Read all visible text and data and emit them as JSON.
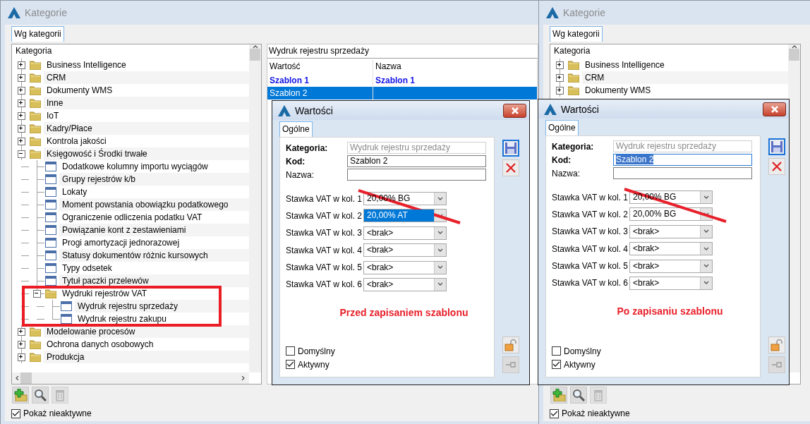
{
  "windows": [
    {
      "title": "Kategorie",
      "tabs": [
        {
          "label": "Wg kategorii",
          "selected": true
        }
      ],
      "tree": {
        "header": "Kategoria",
        "items": [
          {
            "label": "Business Intelligence",
            "kind": "folder",
            "expanded": false,
            "highlighted": false
          },
          {
            "label": "CRM",
            "kind": "folder",
            "expanded": false,
            "highlighted": false
          },
          {
            "label": "Dokumenty WMS",
            "kind": "folder",
            "expanded": false,
            "highlighted": false
          },
          {
            "label": "Inne",
            "kind": "folder",
            "expanded": false,
            "highlighted": false
          },
          {
            "label": "IoT",
            "kind": "folder",
            "expanded": false,
            "highlighted": false
          },
          {
            "label": "Kadry/Płace",
            "kind": "folder",
            "expanded": false,
            "highlighted": false
          },
          {
            "label": "Kontrola jakości",
            "kind": "folder",
            "expanded": false,
            "highlighted": false
          },
          {
            "label": "Księgowość i Środki trwałe",
            "kind": "folder",
            "expanded": true,
            "highlighted": false,
            "children": [
              {
                "label": "Dodatkowe kolumny importu wyciągów",
                "kind": "form",
                "highlighted": false
              },
              {
                "label": "Grupy rejestrów k/b",
                "kind": "form",
                "highlighted": false
              },
              {
                "label": "Lokaty",
                "kind": "form",
                "highlighted": false
              },
              {
                "label": "Moment powstania obowiązku podatkowego",
                "kind": "form",
                "highlighted": false
              },
              {
                "label": "Ograniczenie odliczenia podatku VAT",
                "kind": "form",
                "highlighted": false
              },
              {
                "label": "Powiązanie kont z zestawieniami",
                "kind": "form",
                "highlighted": false
              },
              {
                "label": "Progi amortyzacji jednorazowej",
                "kind": "form",
                "highlighted": false
              },
              {
                "label": "Statusy dokumentów różnic kursowych",
                "kind": "form",
                "highlighted": false
              },
              {
                "label": "Typy odsetek",
                "kind": "form",
                "highlighted": false
              },
              {
                "label": "Tytuł paczki przelewów",
                "kind": "form",
                "highlighted": false
              },
              {
                "label": "Wydruki rejestrów VAT",
                "kind": "folder",
                "expanded": true,
                "highlighted": true,
                "children": [
                  {
                    "label": "Wydruk rejestru sprzedaży",
                    "kind": "form",
                    "highlighted": false
                  },
                  {
                    "label": "Wydruk rejestru zakupu",
                    "kind": "form",
                    "highlighted": false
                  }
                ]
              }
            ]
          },
          {
            "label": "Modelowanie procesów",
            "kind": "folder",
            "expanded": false,
            "highlighted": false
          },
          {
            "label": "Ochrona danych osobowych",
            "kind": "folder",
            "expanded": false,
            "highlighted": false
          },
          {
            "label": "Produkcja",
            "kind": "folder",
            "expanded": false,
            "highlighted": false
          }
        ]
      },
      "values": {
        "title": "Wydruk rejestru sprzedaży",
        "columns": [
          "Wartość",
          "Nazwa"
        ],
        "rows": [
          {
            "cells": [
              "Szablon 1",
              "Szablon 1"
            ],
            "bold": true,
            "selected": false
          },
          {
            "cells": [
              "Szablon 2"
            ],
            "bold": false,
            "selected": true
          }
        ]
      },
      "show_inactive": {
        "label": "Pokaż nieaktywne",
        "checked": true
      }
    },
    {
      "title": "Kategorie",
      "tabs": [
        {
          "label": "Wg kategorii",
          "selected": true
        }
      ],
      "tree": {
        "header": "Kategoria",
        "items": [
          {
            "label": "Business Intelligence",
            "kind": "folder",
            "expanded": false,
            "highlighted": false
          },
          {
            "label": "CRM",
            "kind": "folder",
            "expanded": false,
            "highlighted": false
          },
          {
            "label": "Dokumenty WMS",
            "kind": "folder",
            "expanded": false,
            "highlighted": false
          }
        ]
      },
      "show_inactive": {
        "label": "Pokaż nieaktywne",
        "checked": true
      }
    }
  ],
  "dialogs": [
    {
      "title": "Wartości",
      "tabs": [
        {
          "label": "Ogólne",
          "selected": true
        }
      ],
      "fields": [
        {
          "label": "Kategoria:",
          "value": "Wydruk rejestru sprzedaży",
          "bold": true,
          "disabled": true,
          "text_selected": false
        },
        {
          "label": "Kod:",
          "value": "Szablon 2",
          "bold": true,
          "disabled": false,
          "text_selected": false
        },
        {
          "label": "Nazwa:",
          "bold": false,
          "disabled": false,
          "text_selected": false
        }
      ],
      "rates": [
        {
          "label": "Stawka VAT w kol. 1",
          "value": "20,00% BG",
          "focused": false
        },
        {
          "label": "Stawka VAT w kol. 2",
          "value": "20,00% AT",
          "focused": true
        },
        {
          "label": "Stawka VAT w kol. 3",
          "value": "<brak>",
          "focused": false
        },
        {
          "label": "Stawka VAT w kol. 4",
          "value": "<brak>",
          "focused": false
        },
        {
          "label": "Stawka VAT w kol. 5",
          "value": "<brak>",
          "focused": false
        },
        {
          "label": "Stawka VAT w kol. 6",
          "value": "<brak>",
          "focused": false
        }
      ],
      "note": "Przed zapisaniem szablonu",
      "checkboxes": [
        {
          "label": "Domyślny",
          "checked": false
        },
        {
          "label": "Aktywny",
          "checked": true
        }
      ]
    },
    {
      "title": "Wartości",
      "tabs": [
        {
          "label": "Ogólne",
          "selected": true
        }
      ],
      "fields": [
        {
          "label": "Kategoria:",
          "value": "Wydruk rejestru sprzedaży",
          "bold": true,
          "disabled": true,
          "text_selected": false
        },
        {
          "label": "Kod:",
          "value": "Szablon 2",
          "bold": true,
          "disabled": false,
          "text_selected": true
        },
        {
          "label": "Nazwa:",
          "bold": false,
          "disabled": false,
          "text_selected": false
        }
      ],
      "rates": [
        {
          "label": "Stawka VAT w kol. 1",
          "value": "20,00% BG",
          "focused": false
        },
        {
          "label": "Stawka VAT w kol. 2",
          "value": "20,00% BG",
          "focused": false
        },
        {
          "label": "Stawka VAT w kol. 3",
          "value": "<brak>",
          "focused": false
        },
        {
          "label": "Stawka VAT w kol. 4",
          "value": "<brak>",
          "focused": false
        },
        {
          "label": "Stawka VAT w kol. 5",
          "value": "<brak>",
          "focused": false
        },
        {
          "label": "Stawka VAT w kol. 6",
          "value": "<brak>",
          "focused": false
        }
      ],
      "note": "Po zapisaniu szablonu",
      "checkboxes": [
        {
          "label": "Domyślny",
          "checked": false
        },
        {
          "label": "Aktywny",
          "checked": true
        }
      ]
    }
  ]
}
